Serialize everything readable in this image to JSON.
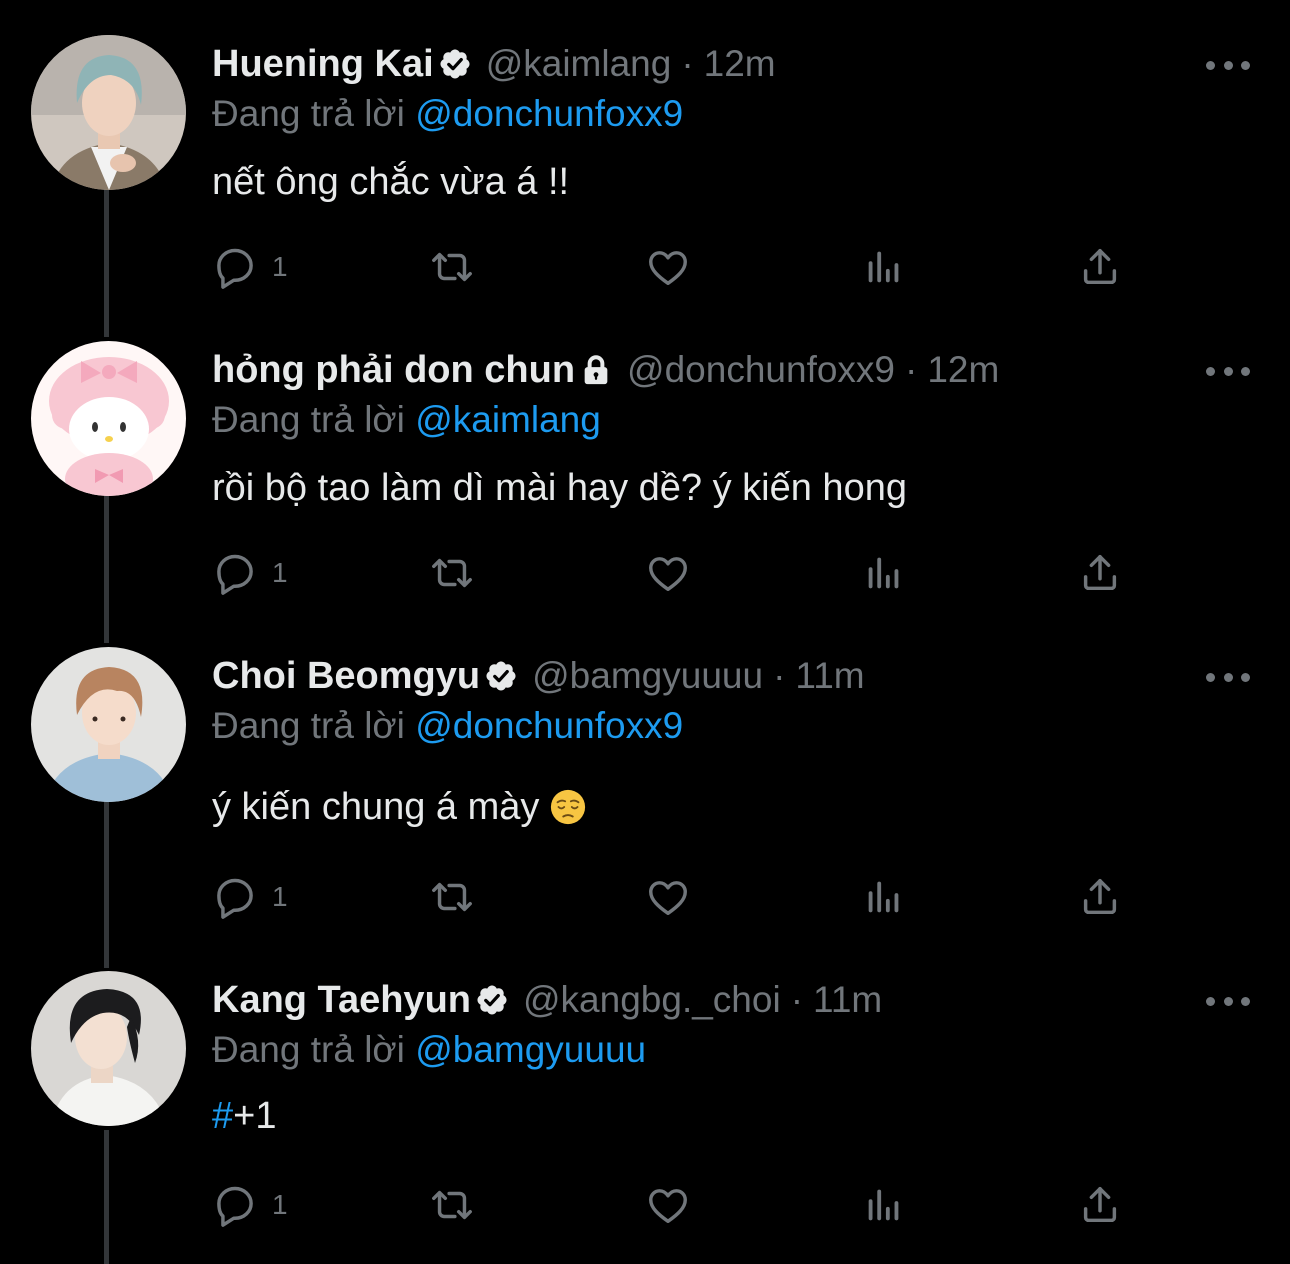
{
  "theme": {
    "background": "#000000",
    "text": "#e7e9ea",
    "secondary": "#71767b",
    "accent": "#1d9bf0"
  },
  "ui": {
    "replying_to_label": "Đang trả lời"
  },
  "tweets": [
    {
      "name": "Huening Kai",
      "badge": "verified-badge-icon",
      "handle": "@kaimlang",
      "separator": "·",
      "time": "12m",
      "replying_to": "@donchunfoxx9",
      "text": "nết ông chắc vừa á !!",
      "reply_count": "1"
    },
    {
      "name": "hỏng phải don chun",
      "badge": "lock-icon",
      "handle": "@donchunfoxx9",
      "separator": "·",
      "time": "12m",
      "replying_to": "@kaimlang",
      "text": "rồi bộ tao làm dì mài hay dề? ý kiến hong",
      "reply_count": "1"
    },
    {
      "name": "Choi Beomgyu",
      "badge": "verified-badge-icon",
      "handle": "@bamgyuuuu",
      "separator": "·",
      "time": "11m",
      "replying_to": "@donchunfoxx9",
      "text": "ý kiến chung á mày",
      "emoji": "pensive-face-emoji",
      "reply_count": "1"
    },
    {
      "name": "Kang Taehyun",
      "badge": "verified-badge-icon",
      "handle": "@kangbg._choi",
      "separator": "·",
      "time": "11m",
      "replying_to": "@bamgyuuuu",
      "hashtag_symbol": "#",
      "text": "+1",
      "reply_count": "1"
    }
  ]
}
